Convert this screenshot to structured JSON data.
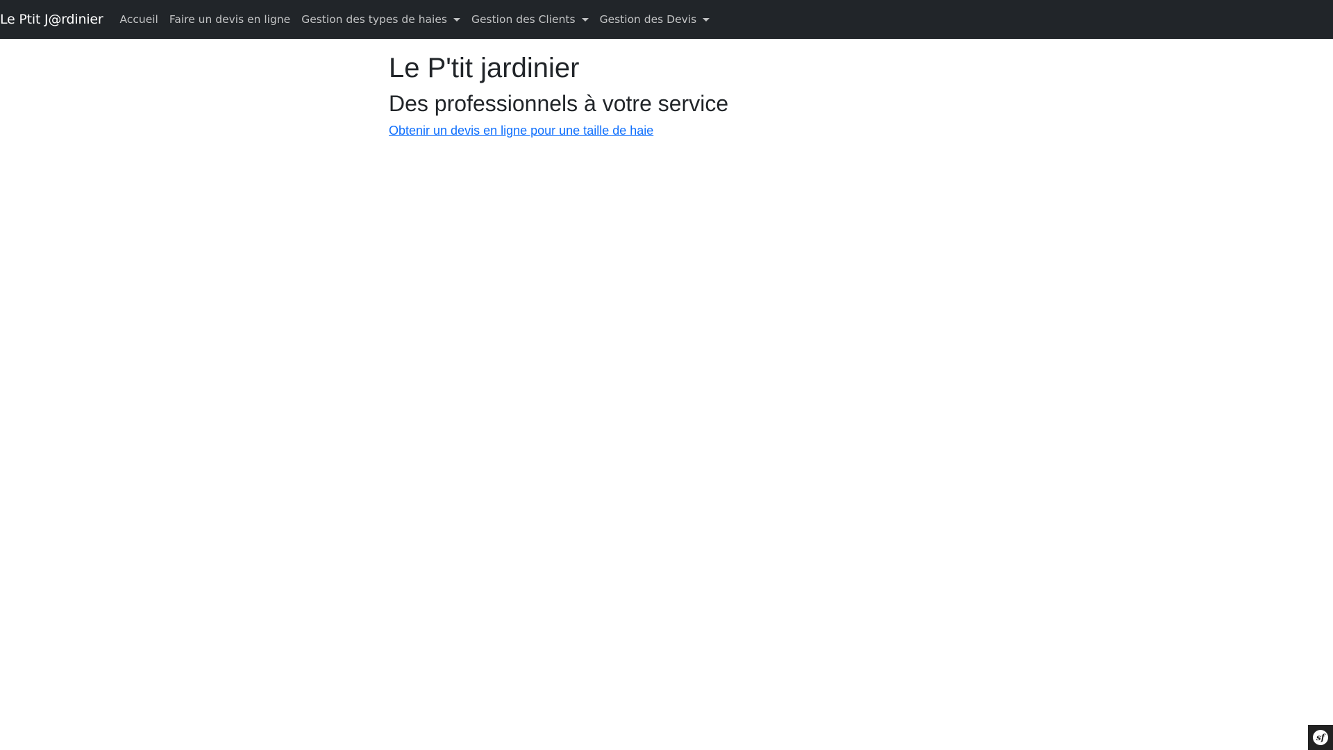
{
  "navbar": {
    "brand": "Le Ptit J@rdinier",
    "items": [
      {
        "label": "Accueil",
        "dropdown": false
      },
      {
        "label": "Faire un devis en ligne",
        "dropdown": false
      },
      {
        "label": "Gestion des types de haies",
        "dropdown": true
      },
      {
        "label": "Gestion des Clients",
        "dropdown": true
      },
      {
        "label": "Gestion des Devis",
        "dropdown": true
      }
    ]
  },
  "main": {
    "title": "Le P'tit jardinier",
    "subtitle": "Des professionnels à votre service",
    "cta_link": "Obtenir un devis en ligne pour une taille de haie"
  },
  "debug_toolbar": {
    "icon": "symfony-logo-icon",
    "logo_text": "sf"
  },
  "colors": {
    "navbar_bg": "#212529",
    "link": "#0d6efd",
    "text": "#212529"
  }
}
